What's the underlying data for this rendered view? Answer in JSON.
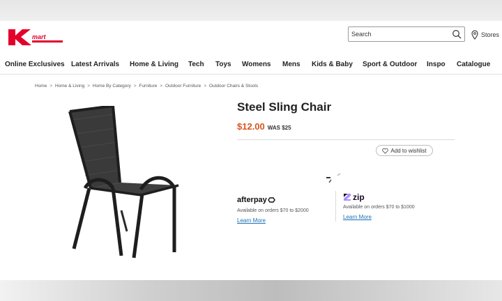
{
  "header": {
    "logo_text": "Kmart",
    "search": {
      "placeholder": "Search"
    },
    "stores_label": "Stores"
  },
  "nav": {
    "items": [
      "Online Exclusives",
      "Latest Arrivals",
      "Home & Living",
      "Tech",
      "Toys",
      "Womens",
      "Mens",
      "Kids & Baby",
      "Sport & Outdoor",
      "Inspo",
      "Catalogue"
    ]
  },
  "breadcrumb": {
    "items": [
      "Home",
      "Home & Living",
      "Home By Category",
      "Furniture",
      "Outdoor Furniture",
      "Outdoor Chairs & Stools"
    ],
    "separator": ">"
  },
  "product": {
    "title": "Steel Sling Chair",
    "price": "$12.00",
    "was_price": "WAS $25",
    "wishlist_label": "Add to wishlist"
  },
  "payments": {
    "afterpay": {
      "name": "afterpay",
      "description": "Available on orders $70 to $2000",
      "link": "Learn More"
    },
    "zip": {
      "name": "zip",
      "description": "Available on orders $70 to $1000",
      "link": "Learn More"
    }
  },
  "colors": {
    "brand_red": "#e4002b",
    "price_orange": "#d9541e",
    "link_blue": "#1c6fb4",
    "zip_purple": "#1a0826"
  }
}
